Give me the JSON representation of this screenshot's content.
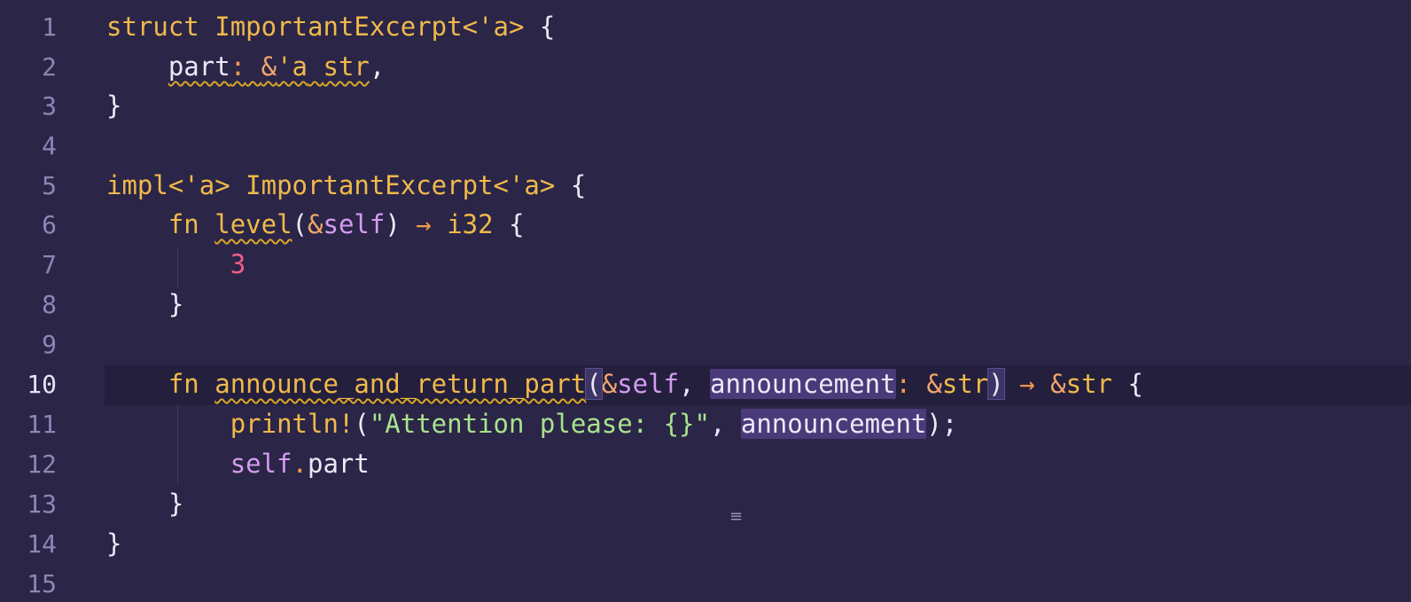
{
  "editor": {
    "language": "rust",
    "active_line": "10",
    "line_numbers": [
      "1",
      "2",
      "3",
      "4",
      "5",
      "6",
      "7",
      "8",
      "9",
      "10",
      "11",
      "12",
      "13",
      "14",
      "15"
    ]
  },
  "code": {
    "l1": {
      "kw": "struct",
      "name": "ImportantExcerpt",
      "lt": "<'a>",
      "brace": "{"
    },
    "l2": {
      "field": "part",
      "colon": ":",
      "amp": "&",
      "lt": "'a",
      "ty": "str",
      "comma": ","
    },
    "l3": {
      "brace": "}"
    },
    "l5": {
      "kw": "impl",
      "lt1": "<'a>",
      "name": "ImportantExcerpt",
      "lt2": "<'a>",
      "brace": "{"
    },
    "l6": {
      "kw": "fn",
      "name": "level",
      "open": "(",
      "amp": "&",
      "self": "self",
      "close": ")",
      "arrow": "→",
      "ty": "i32",
      "brace": "{"
    },
    "l7": {
      "num": "3"
    },
    "l8": {
      "brace": "}"
    },
    "l10": {
      "kw": "fn",
      "name": "announce_and_return_part",
      "open": "(",
      "amp": "&",
      "self": "self",
      "comma": ",",
      "param": "announcement",
      "colon": ":",
      "amp2": "&",
      "ty": "str",
      "close": ")",
      "arrow": "→",
      "amp3": "&",
      "ret": "str",
      "brace": "{"
    },
    "l11": {
      "mac": "println!",
      "open": "(",
      "str": "\"Attention please: {}\"",
      "comma": ",",
      "arg": "announcement",
      "close": ");"
    },
    "l12": {
      "self": "self",
      "dot": ".",
      "field": "part"
    },
    "l13": {
      "brace": "}"
    },
    "l14": {
      "brace": "}"
    }
  },
  "icons": {
    "mouse_cursor": "≡"
  },
  "colors": {
    "background": "#2b2548",
    "keyword": "#f0b94a",
    "number": "#ef5d8b",
    "string": "#a8e38b",
    "self": "#d49cf0",
    "operator": "#f39a4c"
  }
}
